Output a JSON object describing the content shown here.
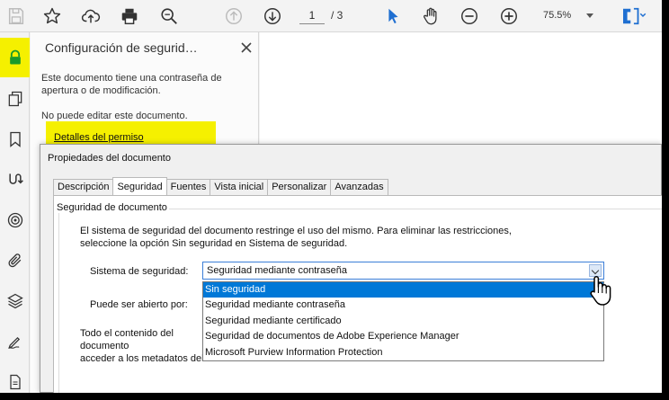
{
  "toolbar": {
    "page_current": "1",
    "page_total": "/ 3",
    "zoom": "75.5%",
    "icons": [
      "save-icon",
      "star-icon",
      "upload-icon",
      "print-icon",
      "zoom-search-icon",
      "page-up-icon",
      "page-down-icon",
      "select-arrow-icon",
      "hand-icon",
      "zoom-out-icon",
      "zoom-in-icon",
      "page-fit-icon"
    ]
  },
  "panel": {
    "title": "Configuración de segurid…",
    "description": "Este documento tiene una contraseña de apertura o de modificación.",
    "no_edit": "No puede editar este documento.",
    "permission_link": "Detalles del permiso"
  },
  "dialog": {
    "title": "Propiedades del documento",
    "tabs": [
      {
        "label": "Descripción"
      },
      {
        "label": "Seguridad"
      },
      {
        "label": "Fuentes"
      },
      {
        "label": "Vista inicial"
      },
      {
        "label": "Personalizar"
      },
      {
        "label": "Avanzadas"
      }
    ],
    "active_tab": "Seguridad",
    "group_label": "Seguridad de documento",
    "security_description": "El sistema de seguridad del documento restringe el uso del mismo. Para eliminar las restricciones, seleccione la opción Sin seguridad en Sistema de seguridad.",
    "system_label": "Sistema de seguridad:",
    "system_value": "Seguridad mediante contraseña",
    "open_label": "Puede ser abierto por:",
    "all_content_text": "Todo el contenido del documento\nacceder a los metadatos del",
    "options": [
      {
        "label": "Sin seguridad",
        "selected": true
      },
      {
        "label": "Seguridad mediante contraseña",
        "selected": false
      },
      {
        "label": "Seguridad mediante certificado",
        "selected": false
      },
      {
        "label": "Seguridad de documentos de Adobe Experience Manager",
        "selected": false
      },
      {
        "label": "Microsoft Purview Information Protection",
        "selected": false
      }
    ]
  },
  "colors": {
    "highlight": "#f5f000",
    "selection": "#0078d7",
    "accent": "#1f6fd1"
  }
}
